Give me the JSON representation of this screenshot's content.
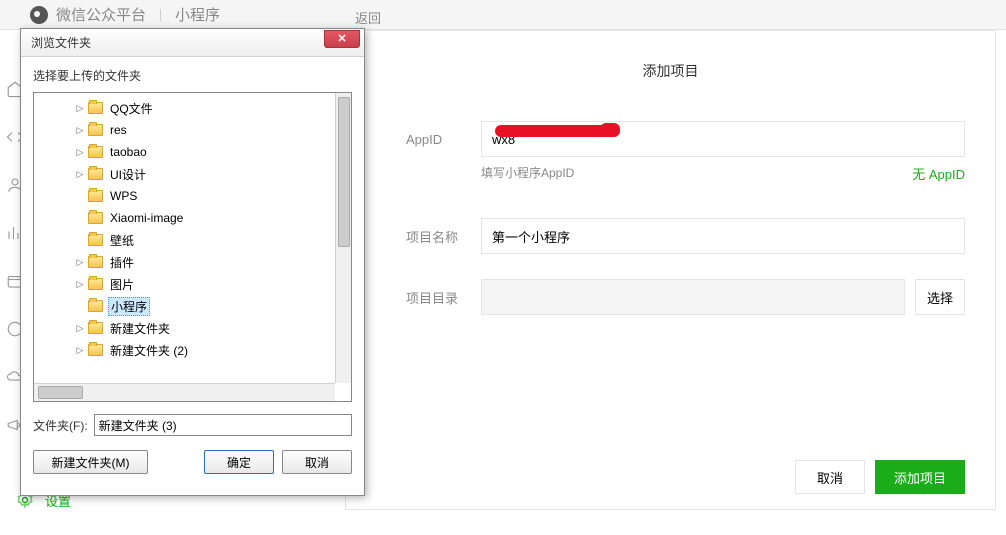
{
  "header": {
    "platform": "微信公众平台",
    "section": "小程序"
  },
  "sidebar": {
    "settings_label": "设置"
  },
  "add_project": {
    "back": "返回",
    "title": "添加项目",
    "appid_label": "AppID",
    "appid_value": "wx8",
    "appid_hint": "填写小程序AppID",
    "no_appid": "无 AppID",
    "name_label": "项目名称",
    "name_value": "第一个小程序",
    "dir_label": "项目目录",
    "dir_value": "",
    "choose_btn": "选择",
    "cancel_btn": "取消",
    "add_btn": "添加项目"
  },
  "dialog": {
    "title": "浏览文件夹",
    "subtitle": "选择要上传的文件夹",
    "tree": [
      {
        "label": "QQ文件",
        "expandable": true
      },
      {
        "label": "res",
        "expandable": true
      },
      {
        "label": "taobao",
        "expandable": true
      },
      {
        "label": "UI设计",
        "expandable": true
      },
      {
        "label": "WPS",
        "expandable": false
      },
      {
        "label": "Xiaomi-image",
        "expandable": false
      },
      {
        "label": "壁纸",
        "expandable": false
      },
      {
        "label": "插件",
        "expandable": true
      },
      {
        "label": "图片",
        "expandable": true
      },
      {
        "label": "小程序",
        "expandable": false,
        "selected": true
      },
      {
        "label": "新建文件夹",
        "expandable": true
      },
      {
        "label": "新建文件夹 (2)",
        "expandable": true
      }
    ],
    "folder_field_label": "文件夹(F):",
    "folder_field_value": "新建文件夹 (3)",
    "new_folder_btn": "新建文件夹(M)",
    "ok_btn": "确定",
    "cancel_btn": "取消"
  }
}
